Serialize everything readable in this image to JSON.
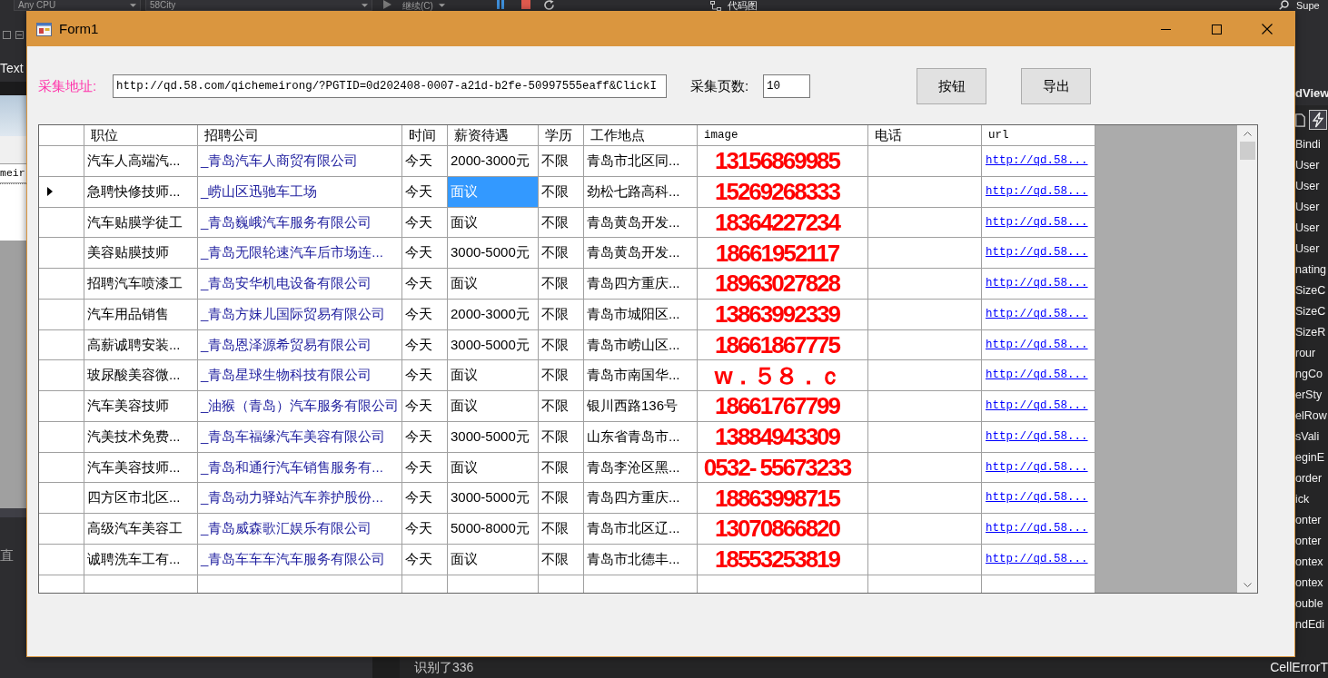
{
  "ide": {
    "toolbar": [
      {
        "kind": "dropdown",
        "label": "Any CPU"
      },
      {
        "kind": "dropdown",
        "label": "58City"
      },
      {
        "kind": "run",
        "label": "继续(C)"
      },
      {
        "kind": "map",
        "label": "代码图"
      }
    ],
    "search_label": "Supe",
    "left_panel": {
      "tab": "Text",
      "field_value": "meir",
      "label": "直"
    },
    "properties": {
      "title": "dView",
      "items": [
        "Bindi",
        "User",
        "User",
        "User",
        "User",
        "User",
        "nating",
        "SizeC",
        "SizeC",
        "SizeR",
        "rour",
        "ngCo",
        "erSty",
        "elRow",
        "sVali",
        "eginE",
        "order",
        "ick",
        "onter",
        "onter",
        "ontex",
        "ontex",
        "ouble",
        "ndEdi"
      ],
      "footer": "CellErrorT"
    },
    "output": "识别了336"
  },
  "window": {
    "title": "Form1"
  },
  "form": {
    "address_label": "采集地址:",
    "address_value": "http://qd.58.com/qichemeirong/?PGTID=0d202408-0007-a21d-b2fe-50997555eaff&ClickI",
    "pages_label": "采集页数:",
    "pages_value": "10",
    "buttons": [
      "按钮",
      "导出"
    ]
  },
  "grid": {
    "columns": [
      {
        "label": "职位",
        "kind": "text"
      },
      {
        "label": "招聘公司",
        "kind": "company"
      },
      {
        "label": "时间",
        "kind": "text"
      },
      {
        "label": "薪资待遇",
        "kind": "text"
      },
      {
        "label": "学历",
        "kind": "text"
      },
      {
        "label": "工作地点",
        "kind": "text"
      },
      {
        "label": "image",
        "kind": "image"
      },
      {
        "label": "电话",
        "kind": "text"
      },
      {
        "label": "url",
        "kind": "link"
      }
    ],
    "rows": [
      {
        "selected": false,
        "cells": [
          {
            "text": "汽车人高端汽...",
            "selected": false
          },
          {
            "text": "_青岛汽车人商贸有限公司",
            "selected": false
          },
          {
            "text": "今天",
            "selected": false
          },
          {
            "text": "2000-3000元",
            "selected": false
          },
          {
            "text": "不限",
            "selected": false
          },
          {
            "text": "青岛市北区同...",
            "selected": false
          },
          {
            "text": "13156869985",
            "selected": false
          },
          {
            "selected": false
          },
          {
            "text": "http://qd.58...",
            "selected": false
          }
        ]
      },
      {
        "selected": true,
        "cells": [
          {
            "text": "急聘快修技师...",
            "selected": false
          },
          {
            "text": "_崂山区迅驰车工场",
            "selected": false
          },
          {
            "text": "今天",
            "selected": false
          },
          {
            "text": "面议",
            "selected": true
          },
          {
            "text": "不限",
            "selected": false
          },
          {
            "text": "劲松七路高科...",
            "selected": false
          },
          {
            "text": "15269268333",
            "selected": false
          },
          {
            "selected": false
          },
          {
            "text": "http://qd.58...",
            "selected": false
          }
        ]
      },
      {
        "selected": false,
        "cells": [
          {
            "text": "汽车贴膜学徒工",
            "selected": false
          },
          {
            "text": "_青岛巍峨汽车服务有限公司",
            "selected": false
          },
          {
            "text": "今天",
            "selected": false
          },
          {
            "text": "面议",
            "selected": false
          },
          {
            "text": "不限",
            "selected": false
          },
          {
            "text": "青岛黄岛开发...",
            "selected": false
          },
          {
            "text": "18364227234",
            "selected": false
          },
          {
            "selected": false
          },
          {
            "text": "http://qd.58...",
            "selected": false
          }
        ]
      },
      {
        "selected": false,
        "cells": [
          {
            "text": "美容贴膜技师",
            "selected": false
          },
          {
            "text": "_青岛无限轮速汽车后市场连...",
            "selected": false
          },
          {
            "text": "今天",
            "selected": false
          },
          {
            "text": "3000-5000元",
            "selected": false
          },
          {
            "text": "不限",
            "selected": false
          },
          {
            "text": "青岛黄岛开发...",
            "selected": false
          },
          {
            "text": "18661952117",
            "selected": false
          },
          {
            "selected": false
          },
          {
            "text": "http://qd.58...",
            "selected": false
          }
        ]
      },
      {
        "selected": false,
        "cells": [
          {
            "text": "招聘汽车喷漆工",
            "selected": false
          },
          {
            "text": "_青岛安华机电设备有限公司",
            "selected": false
          },
          {
            "text": "今天",
            "selected": false
          },
          {
            "text": "面议",
            "selected": false
          },
          {
            "text": "不限",
            "selected": false
          },
          {
            "text": "青岛四方重庆...",
            "selected": false
          },
          {
            "text": "18963027828",
            "selected": false
          },
          {
            "selected": false
          },
          {
            "text": "http://qd.58...",
            "selected": false
          }
        ]
      },
      {
        "selected": false,
        "cells": [
          {
            "text": "汽车用品销售",
            "selected": false
          },
          {
            "text": "_青岛方妹儿国际贸易有限公司",
            "selected": false
          },
          {
            "text": "今天",
            "selected": false
          },
          {
            "text": "2000-3000元",
            "selected": false
          },
          {
            "text": "不限",
            "selected": false
          },
          {
            "text": "青岛市城阳区...",
            "selected": false
          },
          {
            "text": "13863992339",
            "selected": false
          },
          {
            "selected": false
          },
          {
            "text": "http://qd.58...",
            "selected": false
          }
        ]
      },
      {
        "selected": false,
        "cells": [
          {
            "text": "高薪诚聘安装...",
            "selected": false
          },
          {
            "text": "_青岛恩泽源希贸易有限公司",
            "selected": false
          },
          {
            "text": "今天",
            "selected": false
          },
          {
            "text": "3000-5000元",
            "selected": false
          },
          {
            "text": "不限",
            "selected": false
          },
          {
            "text": "青岛市崂山区...",
            "selected": false
          },
          {
            "text": "18661867775",
            "selected": false
          },
          {
            "selected": false
          },
          {
            "text": "http://qd.58...",
            "selected": false
          }
        ]
      },
      {
        "selected": false,
        "cells": [
          {
            "text": "玻尿酸美容微...",
            "selected": false
          },
          {
            "text": "_青岛星球生物科技有限公司",
            "selected": false
          },
          {
            "text": "今天",
            "selected": false
          },
          {
            "text": "面议",
            "selected": false
          },
          {
            "text": "不限",
            "selected": false
          },
          {
            "text": "青岛市南国华...",
            "selected": false
          },
          {
            "text": "w．５８．ｃ",
            "selected": false
          },
          {
            "selected": false
          },
          {
            "text": "http://qd.58...",
            "selected": false
          }
        ]
      },
      {
        "selected": false,
        "cells": [
          {
            "text": "汽车美容技师",
            "selected": false
          },
          {
            "text": "_油猴（青岛）汽车服务有限公司",
            "selected": false
          },
          {
            "text": "今天",
            "selected": false
          },
          {
            "text": "面议",
            "selected": false
          },
          {
            "text": "不限",
            "selected": false
          },
          {
            "text": "银川西路136号",
            "selected": false
          },
          {
            "text": "18661767799",
            "selected": false
          },
          {
            "selected": false
          },
          {
            "text": "http://qd.58...",
            "selected": false
          }
        ]
      },
      {
        "selected": false,
        "cells": [
          {
            "text": "汽美技术免费...",
            "selected": false
          },
          {
            "text": "_青岛车福缘汽车美容有限公司",
            "selected": false
          },
          {
            "text": "今天",
            "selected": false
          },
          {
            "text": "3000-5000元",
            "selected": false
          },
          {
            "text": "不限",
            "selected": false
          },
          {
            "text": "山东省青岛市...",
            "selected": false
          },
          {
            "text": "13884943309",
            "selected": false
          },
          {
            "selected": false
          },
          {
            "text": "http://qd.58...",
            "selected": false
          }
        ]
      },
      {
        "selected": false,
        "cells": [
          {
            "text": "汽车美容技师...",
            "selected": false
          },
          {
            "text": "_青岛和通行汽车销售服务有...",
            "selected": false
          },
          {
            "text": "今天",
            "selected": false
          },
          {
            "text": "面议",
            "selected": false
          },
          {
            "text": "不限",
            "selected": false
          },
          {
            "text": "青岛李沧区黑...",
            "selected": false
          },
          {
            "text": "0532- 55673233",
            "selected": false
          },
          {
            "selected": false
          },
          {
            "text": "http://qd.58...",
            "selected": false
          }
        ]
      },
      {
        "selected": false,
        "cells": [
          {
            "text": "四方区市北区...",
            "selected": false
          },
          {
            "text": "_青岛动力驿站汽车养护股份...",
            "selected": false
          },
          {
            "text": "今天",
            "selected": false
          },
          {
            "text": "3000-5000元",
            "selected": false
          },
          {
            "text": "不限",
            "selected": false
          },
          {
            "text": "青岛四方重庆...",
            "selected": false
          },
          {
            "text": "18863998715",
            "selected": false
          },
          {
            "selected": false
          },
          {
            "text": "http://qd.58...",
            "selected": false
          }
        ]
      },
      {
        "selected": false,
        "cells": [
          {
            "text": "高级汽车美容工",
            "selected": false
          },
          {
            "text": "_青岛威森歌汇娱乐有限公司",
            "selected": false
          },
          {
            "text": "今天",
            "selected": false
          },
          {
            "text": "5000-8000元",
            "selected": false
          },
          {
            "text": "不限",
            "selected": false
          },
          {
            "text": "青岛市北区辽...",
            "selected": false
          },
          {
            "text": "13070866820",
            "selected": false
          },
          {
            "selected": false
          },
          {
            "text": "http://qd.58...",
            "selected": false
          }
        ]
      },
      {
        "selected": false,
        "cells": [
          {
            "text": "诚聘洗车工有...",
            "selected": false
          },
          {
            "text": "_青岛车车车汽车服务有限公司",
            "selected": false
          },
          {
            "text": "今天",
            "selected": false
          },
          {
            "text": "面议",
            "selected": false
          },
          {
            "text": "不限",
            "selected": false
          },
          {
            "text": "青岛市北德丰...",
            "selected": false
          },
          {
            "text": "18553253819",
            "selected": false
          },
          {
            "selected": false
          },
          {
            "text": "http://qd.58...",
            "selected": false
          }
        ]
      },
      {
        "selected": false,
        "cells": [
          {
            "selected": false
          },
          {
            "selected": false
          },
          {
            "selected": false
          },
          {
            "selected": false
          },
          {
            "selected": false
          },
          {
            "selected": false
          },
          {
            "selected": false
          },
          {
            "selected": false
          },
          {
            "selected": false
          }
        ]
      }
    ]
  }
}
